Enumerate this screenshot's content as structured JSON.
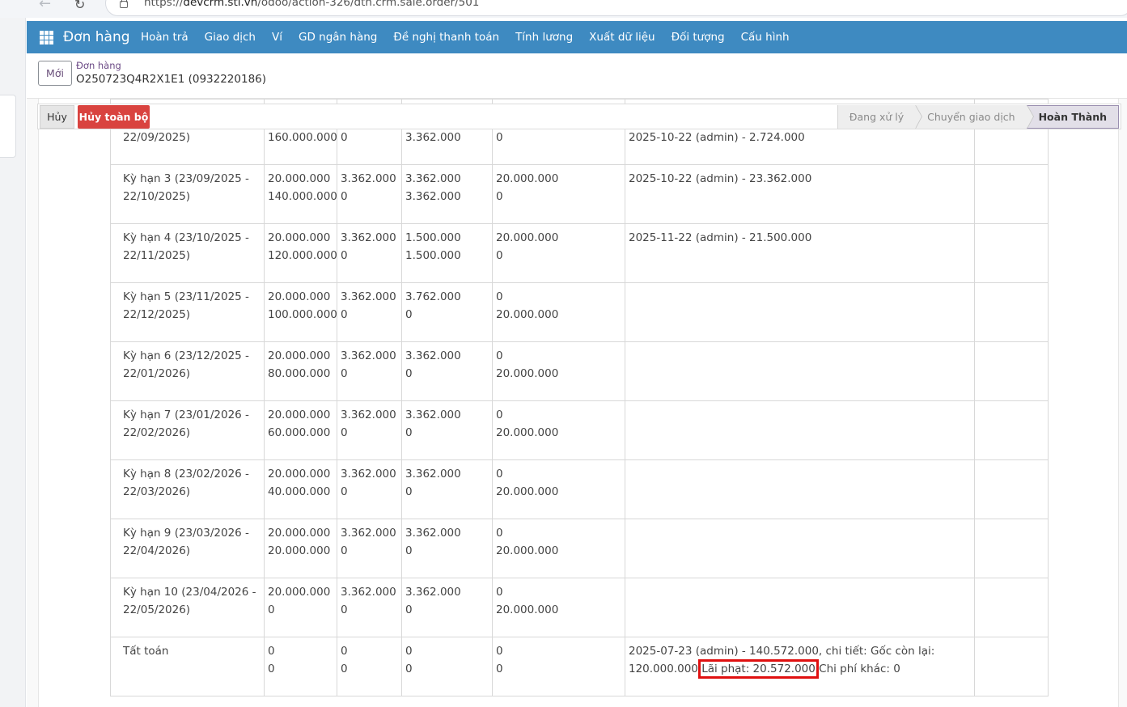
{
  "browser": {
    "url_prefix": "https://",
    "url_host": "devcrm.stl.vn",
    "url_path": "/odoo/action-326/dth.crm.sale.order/501"
  },
  "topnav": {
    "brand": "Đơn hàng",
    "menu": [
      "Hoàn trả",
      "Giao dịch",
      "Ví",
      "GD ngân hàng",
      "Đề nghị thanh toán",
      "Tính lương",
      "Xuất dữ liệu",
      "Đối tượng",
      "Cấu hình"
    ]
  },
  "control": {
    "new_label": "Mới",
    "breadcrumb_parent": "Đơn hàng",
    "breadcrumb_current": "O250723Q4R2X1E1 (0932220186)"
  },
  "statusbar": {
    "cancel_label": "Hủy",
    "cancel_all_label": "Hủy toàn bộ",
    "stages": [
      {
        "label": "Đang xử lý",
        "active": false
      },
      {
        "label": "Chuyển giao dịch",
        "active": false
      },
      {
        "label": "Hoàn Thành",
        "active": true
      }
    ]
  },
  "table": {
    "rows": [
      {
        "term": [
          "22/09/2025)",
          ""
        ],
        "c1": [
          "160.000.000",
          ""
        ],
        "c2": [
          "0",
          ""
        ],
        "c3": [
          "3.362.000",
          ""
        ],
        "c4": [
          "0",
          ""
        ],
        "note": "2025-10-22 (admin) - 2.724.000",
        "partial_top": true
      },
      {
        "term": [
          "Kỳ hạn 3 (23/09/2025 -",
          "22/10/2025)"
        ],
        "c1": [
          "20.000.000",
          "140.000.000"
        ],
        "c2": [
          "3.362.000",
          "0"
        ],
        "c3": [
          "3.362.000",
          "3.362.000"
        ],
        "c4": [
          "20.000.000",
          "0"
        ],
        "note": "2025-10-22 (admin) - 23.362.000"
      },
      {
        "term": [
          "Kỳ hạn 4 (23/10/2025 -",
          "22/11/2025)"
        ],
        "c1": [
          "20.000.000",
          "120.000.000"
        ],
        "c2": [
          "3.362.000",
          "0"
        ],
        "c3": [
          "1.500.000",
          "1.500.000"
        ],
        "c4": [
          "20.000.000",
          "0"
        ],
        "note": "2025-11-22 (admin) - 21.500.000"
      },
      {
        "term": [
          "Kỳ hạn 5 (23/11/2025 -",
          "22/12/2025)"
        ],
        "c1": [
          "20.000.000",
          "100.000.000"
        ],
        "c2": [
          "3.362.000",
          "0"
        ],
        "c3": [
          "3.762.000",
          "0"
        ],
        "c4": [
          "0",
          "20.000.000"
        ],
        "note": ""
      },
      {
        "term": [
          "Kỳ hạn 6 (23/12/2025 -",
          "22/01/2026)"
        ],
        "c1": [
          "20.000.000",
          "80.000.000"
        ],
        "c2": [
          "3.362.000",
          "0"
        ],
        "c3": [
          "3.362.000",
          "0"
        ],
        "c4": [
          "0",
          "20.000.000"
        ],
        "note": ""
      },
      {
        "term": [
          "Kỳ hạn 7 (23/01/2026 -",
          "22/02/2026)"
        ],
        "c1": [
          "20.000.000",
          "60.000.000"
        ],
        "c2": [
          "3.362.000",
          "0"
        ],
        "c3": [
          "3.362.000",
          "0"
        ],
        "c4": [
          "0",
          "20.000.000"
        ],
        "note": ""
      },
      {
        "term": [
          "Kỳ hạn 8 (23/02/2026 -",
          "22/03/2026)"
        ],
        "c1": [
          "20.000.000",
          "40.000.000"
        ],
        "c2": [
          "3.362.000",
          "0"
        ],
        "c3": [
          "3.362.000",
          "0"
        ],
        "c4": [
          "0",
          "20.000.000"
        ],
        "note": ""
      },
      {
        "term": [
          "Kỳ hạn 9 (23/03/2026 -",
          "22/04/2026)"
        ],
        "c1": [
          "20.000.000",
          "20.000.000"
        ],
        "c2": [
          "3.362.000",
          "0"
        ],
        "c3": [
          "3.362.000",
          "0"
        ],
        "c4": [
          "0",
          "20.000.000"
        ],
        "note": ""
      },
      {
        "term": [
          "Kỳ hạn 10 (23/04/2026 -",
          "22/05/2026)"
        ],
        "c1": [
          "20.000.000",
          "0"
        ],
        "c2": [
          "3.362.000",
          "0"
        ],
        "c3": [
          "3.362.000",
          "0"
        ],
        "c4": [
          "0",
          "20.000.000"
        ],
        "note": ""
      }
    ],
    "settlement": {
      "term": "Tất toán",
      "c1": [
        "0",
        "0"
      ],
      "c2": [
        "0",
        "0"
      ],
      "c3": [
        "0",
        "0"
      ],
      "c4": [
        "0",
        "0"
      ],
      "note_a": "2025-07-23 (admin) - 140.572.000, chi tiết: Gốc còn lại: 120.000.000 ",
      "note_highlight": "Lãi phạt: 20.572.000",
      "note_b": " Chi phí khác: 0"
    }
  }
}
